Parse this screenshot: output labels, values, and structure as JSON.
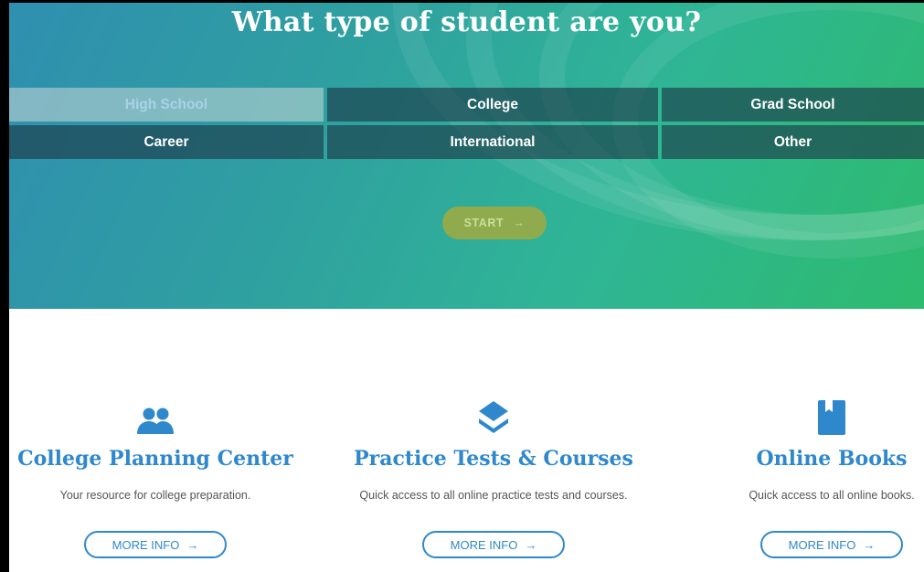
{
  "hero": {
    "title": "What type of student are you?",
    "student_types": [
      [
        "High School",
        "College",
        "Grad School"
      ],
      [
        "Career",
        "International",
        "Other"
      ]
    ],
    "selected": "High School",
    "start_label": "START",
    "start_icon": "arrow-right-icon"
  },
  "cards": [
    {
      "title": "College Planning Center",
      "description": "Your resource for college preparation.",
      "button": "MORE INFO",
      "icon": "users-icon"
    },
    {
      "title": "Practice Tests & Courses",
      "description": "Quick access to all online practice tests and courses.",
      "button": "MORE INFO",
      "icon": "layers-icon"
    },
    {
      "title": "Online Books",
      "description": "Quick access to all online books.",
      "button": "MORE INFO",
      "icon": "book-icon"
    }
  ],
  "colors": {
    "accent_blue": "#2f88cc",
    "start_button": "#8fab4d"
  }
}
